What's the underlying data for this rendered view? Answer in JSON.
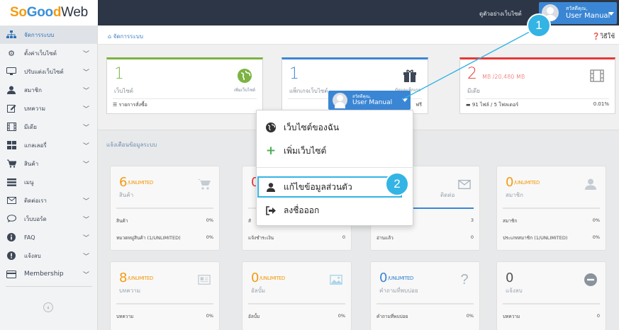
{
  "logo": {
    "part1": "So",
    "part2": "Goo",
    "part3": "d",
    "part4": "Web"
  },
  "topbar": {
    "link": "ดูตัวอย่างเว็บไซต์",
    "user_greeting": "สวัสดีคุณ,",
    "user_name": "User Manual"
  },
  "sidebar": {
    "items": [
      {
        "label": "จัดการระบบ",
        "icon": "sitemap-icon"
      },
      {
        "label": "ตั้งค่าเว็บไซต์",
        "icon": "gear-icon"
      },
      {
        "label": "ปรับแต่งเว็บไซต์",
        "icon": "monitor-icon"
      },
      {
        "label": "สมาชิก",
        "icon": "user-icon"
      },
      {
        "label": "บทความ",
        "icon": "edit-icon"
      },
      {
        "label": "มีเดีย",
        "icon": "film-icon"
      },
      {
        "label": "แกลเลอรี่",
        "icon": "gallery-icon"
      },
      {
        "label": "สินค้า",
        "icon": "cart-icon"
      },
      {
        "label": "เมนู",
        "icon": "menu-icon"
      },
      {
        "label": "ติดต่อเรา",
        "icon": "mail-icon"
      },
      {
        "label": "เว็บบอร์ด",
        "icon": "chat-icon"
      },
      {
        "label": "FAQ",
        "icon": "info-icon"
      },
      {
        "label": "แจ้งลบ",
        "icon": "alert-icon"
      },
      {
        "label": "Membership",
        "icon": "card-icon"
      }
    ]
  },
  "breadcrumb": {
    "label": "จัดการระบบ",
    "help": "วิธีใช้"
  },
  "stat_boxes": [
    {
      "number": "1",
      "label": "เว็บไซต์",
      "action": "เพิ่มเว็บไซต์",
      "footer": "รายการสั่งซื้อ",
      "right": "",
      "color": "#7cb342"
    },
    {
      "number": "1",
      "label": "แพ็กเกจเว็บไซต์",
      "action": "ข้อมูลแพ็กเกจ",
      "footer": "",
      "right": "ฟรี",
      "color": "#3a86d4"
    },
    {
      "number": "2",
      "unit": "MB /20,480 MB",
      "label": "มีเดีย",
      "action": "",
      "footer": "91 ไฟล์ / 5 โฟลเดอร์",
      "right": "0.01%",
      "color": "#e53935"
    }
  ],
  "section_title": "แจ้งเตือนข้อมูลระบบ",
  "mini_cards": [
    {
      "number": "6",
      "suffix": "/UNLIMITED",
      "label": "สินค้า",
      "color": "#f39c12",
      "rows": [
        [
          "สินค้า",
          "0%"
        ],
        [
          "หมวดหมู่สินค้า (1/UNLIMITED)",
          "0%"
        ]
      ]
    },
    {
      "number": "0",
      "suffix": "",
      "label": "",
      "color": "#f39c12",
      "rows": [
        [
          "สั",
          ""
        ],
        [
          "แจ้งชำระเงิน",
          "0"
        ]
      ]
    },
    {
      "number": "",
      "suffix": "",
      "label": "ติดต่อ",
      "color": "#3a86d4",
      "rows": [
        [
          "",
          "3"
        ],
        [
          "อ่านแล้ว",
          "0"
        ]
      ]
    },
    {
      "number": "0",
      "suffix": "/UNLIMITED",
      "label": "สมาชิก",
      "color": "#f39c12",
      "rows": [
        [
          "สมาชิก",
          "0%"
        ],
        [
          "ประเภทสมาชิก (1/UNLIMITED)",
          "0%"
        ]
      ]
    },
    {
      "number": "8",
      "suffix": "/UNLIMITED",
      "label": "บทความ",
      "color": "#f39c12",
      "rows": [
        [
          "บทความ",
          "0%"
        ],
        [
          "",
          ""
        ]
      ]
    },
    {
      "number": "0",
      "suffix": "/UNLIMITED",
      "label": "อัลบั้ม",
      "color": "#f39c12",
      "rows": [
        [
          "อัลบั้ม",
          "0%"
        ],
        [
          "",
          ""
        ]
      ]
    },
    {
      "number": "0",
      "suffix": "/UNLIMITED",
      "label": "คำถามที่พบบ่อย",
      "color": "#3a86d4",
      "rows": [
        [
          "คำถามที่พบบ่อย",
          "0%"
        ],
        [
          "",
          ""
        ]
      ]
    },
    {
      "number": "0",
      "suffix": "",
      "label": "แจ้งลบ",
      "color": "#555",
      "rows": [
        [
          "บทความ",
          "0"
        ],
        [
          "",
          ""
        ]
      ]
    }
  ],
  "dropdown": {
    "items": [
      {
        "label": "เว็บไซต์ของฉัน",
        "icon": "globe-icon"
      },
      {
        "label": "เพิ่มเว็บไซต์",
        "icon": "plus-icon"
      },
      {
        "label": "แก้ไขข้อมูลส่วนตัว",
        "icon": "user-icon"
      },
      {
        "label": "ลงชื่อออก",
        "icon": "sign-out-icon"
      }
    ]
  },
  "callouts": {
    "one": "1",
    "two": "2"
  }
}
